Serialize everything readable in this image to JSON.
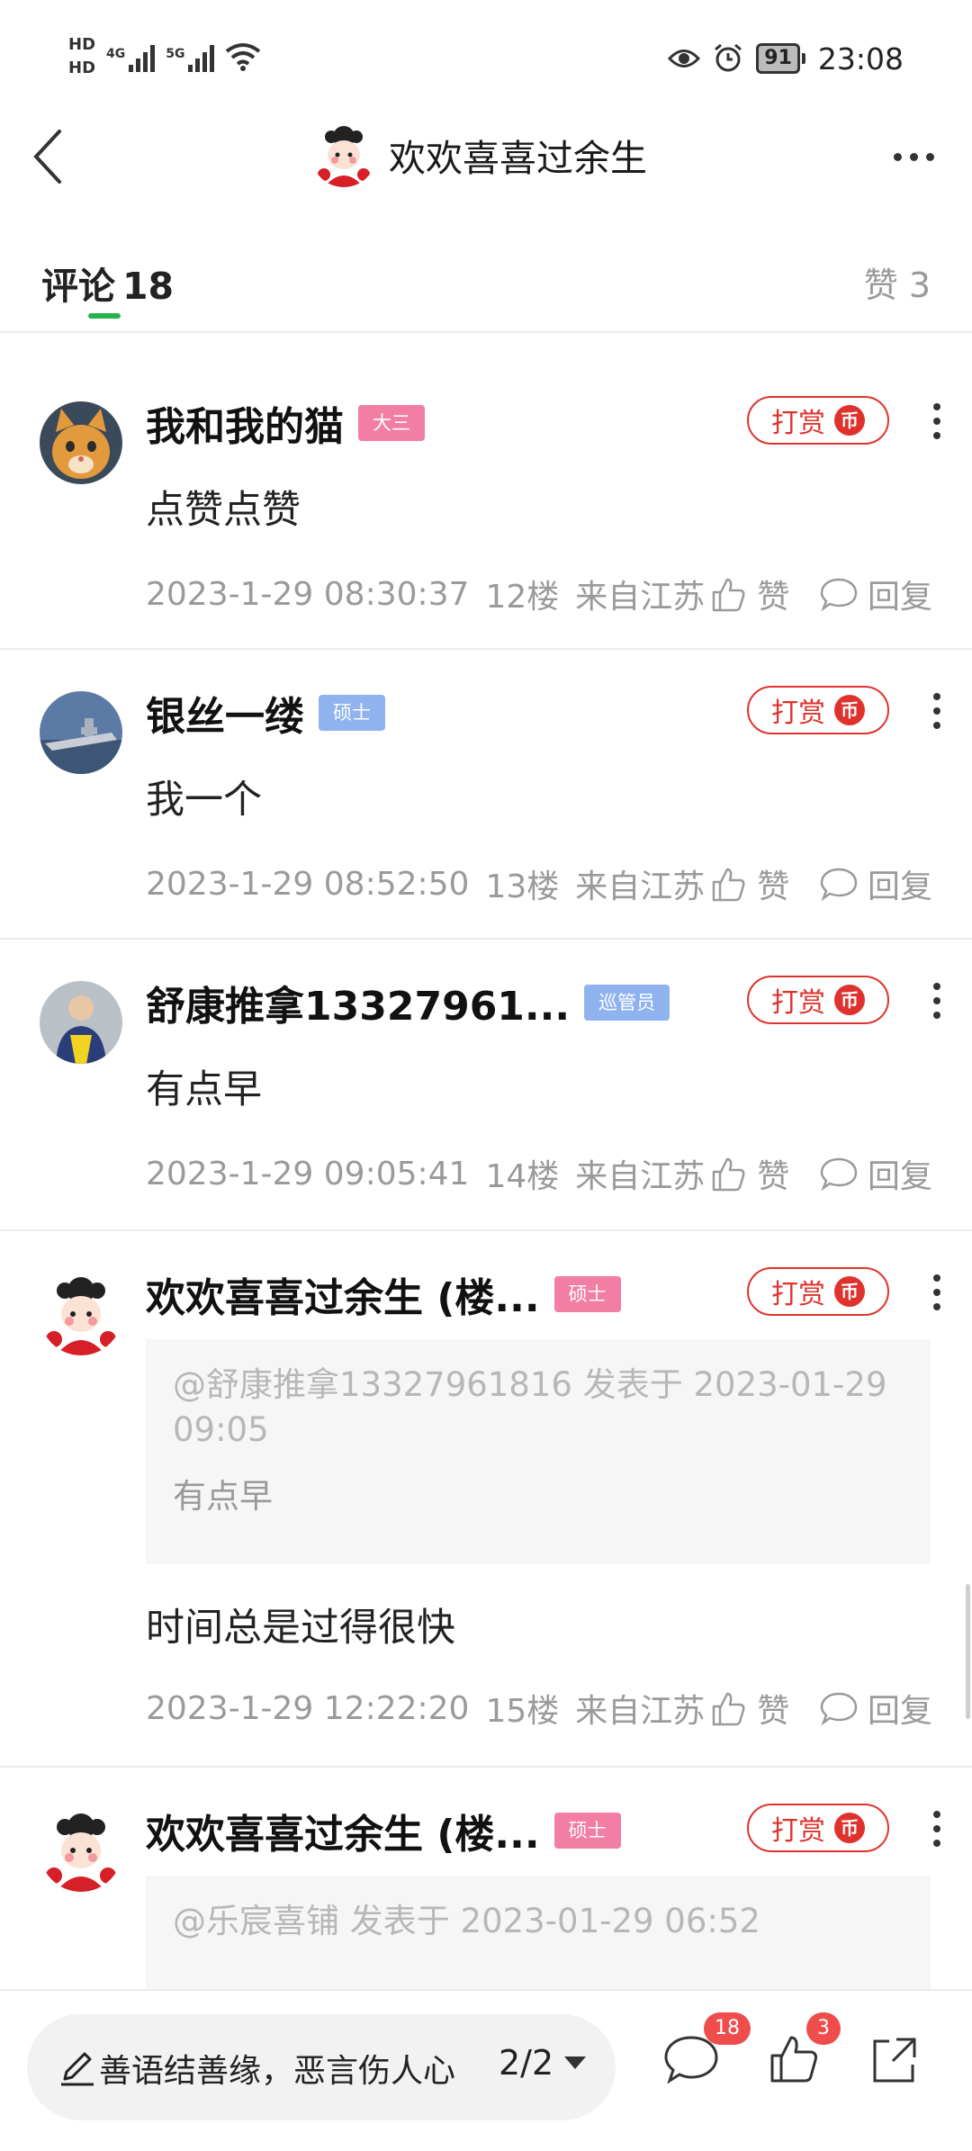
{
  "status_bar": {
    "hd1": "HD",
    "hd2": "HD",
    "net1": "4G",
    "net2": "5G",
    "battery": "91",
    "time": "23:08"
  },
  "header": {
    "title": "欢欢喜喜过余生"
  },
  "tabs": {
    "comments_label": "评论",
    "comments_count": "18",
    "likes_label": "赞 3"
  },
  "tip_label": "打赏",
  "tip_coin": "币",
  "like_label": "赞",
  "reply_label": "回复",
  "comments": [
    {
      "name": "我和我的猫",
      "badge": "大三",
      "badge_color": "#f27ea3",
      "content": "点赞点赞",
      "time": "2023-1-29 08:30:37",
      "floor": "12楼",
      "loc": "来自江苏"
    },
    {
      "name": "银丝一缕",
      "badge": "硕士",
      "badge_color": "#8fb3ee",
      "content": "我一个",
      "time": "2023-1-29 08:52:50",
      "floor": "13楼",
      "loc": "来自江苏"
    },
    {
      "name": "舒康推拿13327961...",
      "badge": "巡管员",
      "badge_color": "#8fb3ee",
      "content": "有点早",
      "time": "2023-1-29 09:05:41",
      "floor": "14楼",
      "loc": "来自江苏"
    },
    {
      "name": "欢欢喜喜过余生 (楼...",
      "badge": "硕士",
      "badge_color": "#f27ea3",
      "quote_head": "@舒康推拿13327961816 发表于 2023-01-29 09:05",
      "quote_body": "有点早",
      "content": "时间总是过得很快",
      "time": "2023-1-29 12:22:20",
      "floor": "15楼",
      "loc": "来自江苏"
    },
    {
      "name": "欢欢喜喜过余生 (楼...",
      "badge": "硕士",
      "badge_color": "#f27ea3",
      "quote_head": "@乐宸喜铺 发表于 2023-01-29 06:52"
    }
  ],
  "bottom": {
    "placeholder": "善语结善缘，恶言伤人心",
    "pager": "2/2",
    "comment_count": "18",
    "like_count": "3"
  }
}
